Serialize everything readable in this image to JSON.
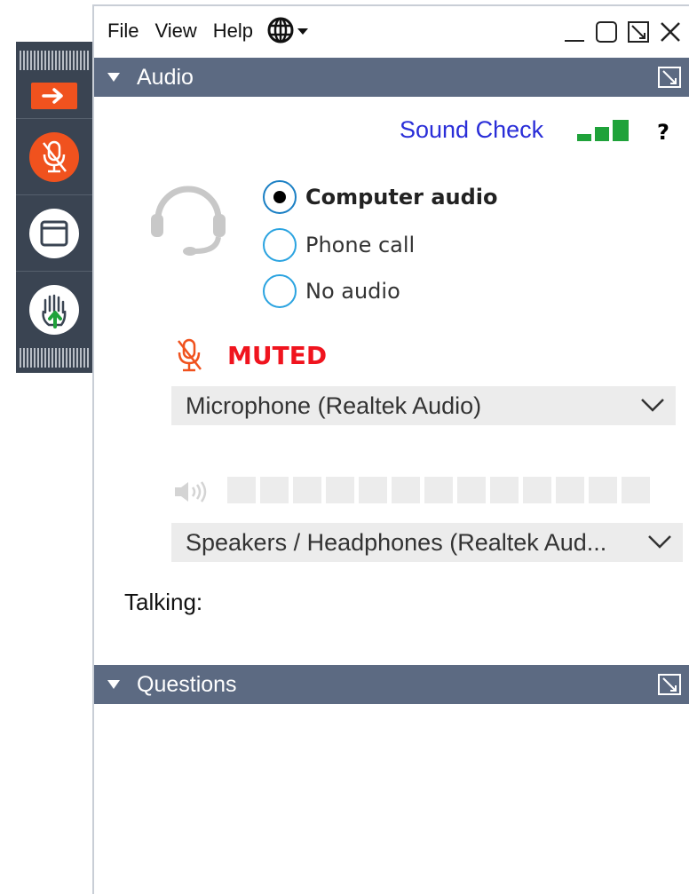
{
  "menu": {
    "file": "File",
    "view": "View",
    "help": "Help"
  },
  "audio_panel": {
    "title": "Audio",
    "sound_check": "Sound Check",
    "help": "?",
    "options": [
      "Computer audio",
      "Phone call",
      "No audio"
    ],
    "selected_option": "Computer audio",
    "mute_status": "MUTED",
    "microphone": "Microphone (Realtek Audio)",
    "speakers": "Speakers / Headphones (Realtek Aud...",
    "speaker_level_segments": 13,
    "speaker_level": 0,
    "talking_label": "Talking:"
  },
  "questions_panel": {
    "title": "Questions"
  },
  "colors": {
    "accent_orange": "#f0521e",
    "header_bg": "#5c6a82",
    "strip_bg": "#3a4452",
    "link_blue": "#2a2ed8",
    "muted_red": "#f0141e",
    "signal_green": "#1fa23a",
    "radio_blue": "#2aa3e0"
  }
}
